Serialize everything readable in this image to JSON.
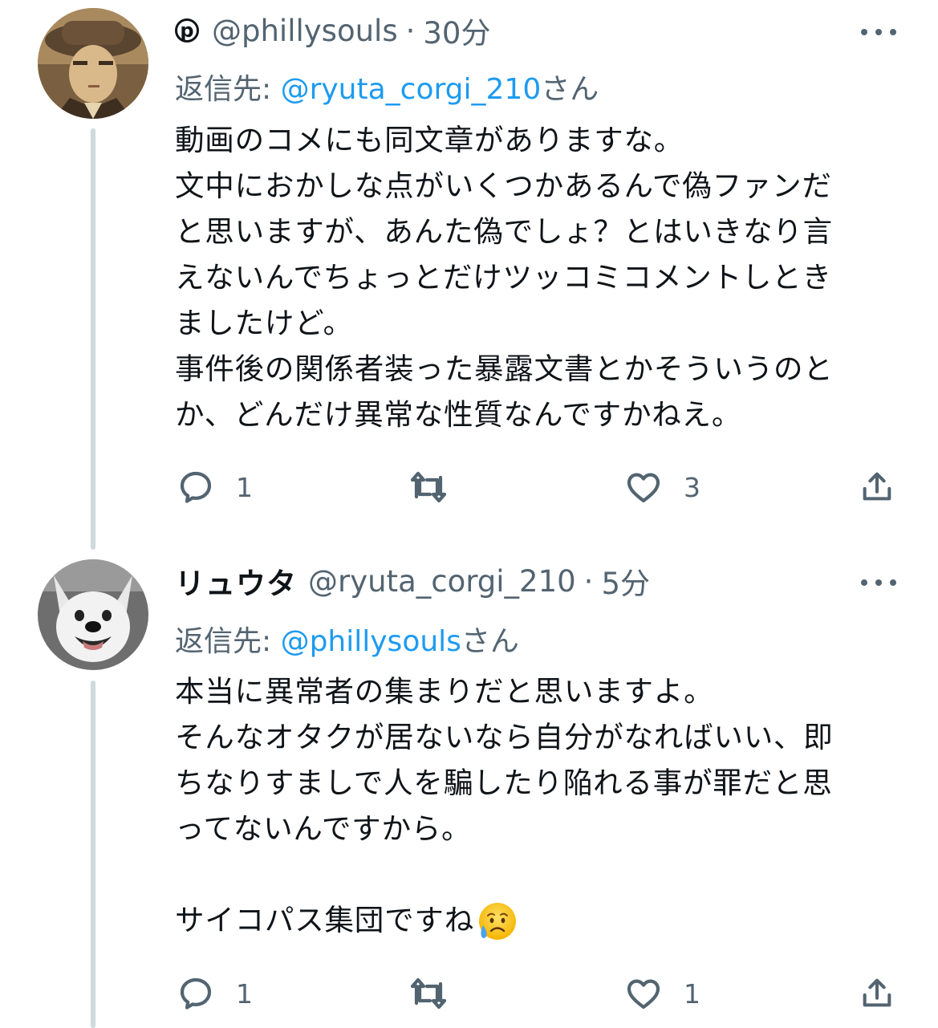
{
  "tweets": [
    {
      "display_name": "",
      "badge": "p",
      "handle": "@phillysouls",
      "separator": "·",
      "time": "30分",
      "reply_label": "返信先: ",
      "reply_mention": "@ryuta_corgi_210",
      "reply_suffix": "さん",
      "text_lines": [
        "動画のコメにも同文章がありますな。",
        "文中におかしな点がいくつかあるんで偽ファンだ",
        "と思いますが、あんた偽でしょ？とはいきなり言",
        "えないんでちょっとだけツッコミコメントしとき",
        "ましたけど。",
        "事件後の関係者装った暴露文書とかそういうのと",
        "か、どんだけ異常な性質なんですかねえ。"
      ],
      "reply_count": "1",
      "retweet_count": "",
      "like_count": "3"
    },
    {
      "display_name": "リュウタ",
      "handle": "@ryuta_corgi_210",
      "separator": "·",
      "time": "5分",
      "reply_label": "返信先: ",
      "reply_mention": "@phillysouls",
      "reply_suffix": "さん",
      "text_lines": [
        "本当に異常者の集まりだと思いますよ。",
        "そんなオタクが居ないなら自分がなればいい、即",
        "ちなりすましで人を騙したり陥れる事が罪だと思",
        "ってないんですから。",
        "",
        "サイコパス集団ですね"
      ],
      "emoji": "sad-but-relieved-face-icon",
      "reply_count": "1",
      "retweet_count": "",
      "like_count": "1"
    }
  ],
  "colors": {
    "text": "#0f1419",
    "secondary": "#536471",
    "link": "#1d9bf0",
    "thread_line": "#cfd9de"
  }
}
